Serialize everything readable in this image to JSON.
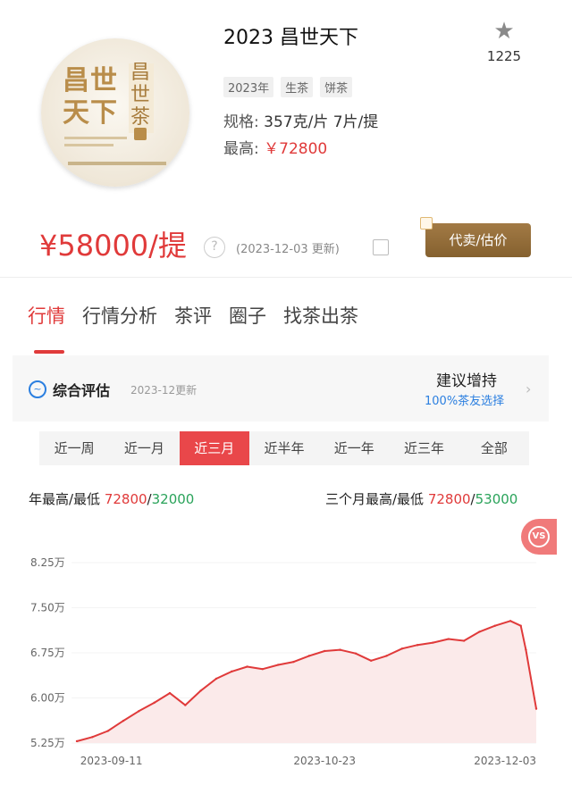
{
  "product": {
    "title": "2023 昌世天下",
    "favorite_count": "1225",
    "tags": [
      "2023年",
      "生茶",
      "饼茶"
    ],
    "spec_label": "规格: ",
    "spec_value": "357克/片 7片/提",
    "max_label": "最高: ",
    "max_value": "￥72800",
    "image_text_main": "昌世天下",
    "image_text_side": "昌世茶",
    "icon": "star-icon"
  },
  "price": {
    "value": "¥58000/提",
    "updated": "(2023-12-03 更新)",
    "sell_button": "代卖/估价"
  },
  "tabs": [
    "行情",
    "行情分析",
    "茶评",
    "圈子",
    "找茶出茶"
  ],
  "evaluation": {
    "label": "综合评估",
    "date": "2023-12更新",
    "advice": "建议增持",
    "advice_sub": "100%茶友选择"
  },
  "ranges": [
    "近一周",
    "近一月",
    "近三月",
    "近半年",
    "近一年",
    "近三年",
    "全部"
  ],
  "active_range": "近三月",
  "stats": {
    "year_label": "年最高/最低 ",
    "year_high": "72800",
    "year_low": "32000",
    "three_month_label": "三个月最高/最低 ",
    "three_month_high": "72800",
    "three_month_low": "53000",
    "slash": "/"
  },
  "vs_badge": "VS",
  "colors": {
    "accent": "#e03a3a",
    "green": "#2aa35a",
    "blue": "#2b7fe0",
    "brown": "#96703d"
  },
  "chart_data": {
    "type": "area",
    "y_tick_labels": [
      "8.25万",
      "7.50万",
      "6.75万",
      "6.00万",
      "5.25万"
    ],
    "y_ticks": [
      8.25,
      7.5,
      6.75,
      6.0,
      5.25
    ],
    "ylim": [
      5.25,
      8.25
    ],
    "x_tick_labels": [
      "2023-09-11",
      "2023-10-23",
      "2023-12-03"
    ],
    "x": [
      "2023-09-05",
      "2023-09-08",
      "2023-09-11",
      "2023-09-14",
      "2023-09-17",
      "2023-09-20",
      "2023-09-23",
      "2023-09-26",
      "2023-09-29",
      "2023-10-02",
      "2023-10-05",
      "2023-10-08",
      "2023-10-11",
      "2023-10-14",
      "2023-10-17",
      "2023-10-20",
      "2023-10-23",
      "2023-10-26",
      "2023-10-29",
      "2023-11-01",
      "2023-11-04",
      "2023-11-07",
      "2023-11-10",
      "2023-11-13",
      "2023-11-16",
      "2023-11-19",
      "2023-11-22",
      "2023-11-25",
      "2023-11-28",
      "2023-11-30",
      "2023-12-01",
      "2023-12-03"
    ],
    "series": [
      {
        "values": [
          5.28,
          5.35,
          5.45,
          5.62,
          5.78,
          5.92,
          6.08,
          5.88,
          6.12,
          6.32,
          6.44,
          6.52,
          6.48,
          6.55,
          6.6,
          6.7,
          6.78,
          6.8,
          6.74,
          6.62,
          6.7,
          6.82,
          6.88,
          6.92,
          6.98,
          6.95,
          7.1,
          7.2,
          7.28,
          7.2,
          6.8,
          5.82
        ]
      }
    ],
    "grid": false,
    "fill_color": "#fbeaea",
    "line_color": "#e03a3a"
  }
}
